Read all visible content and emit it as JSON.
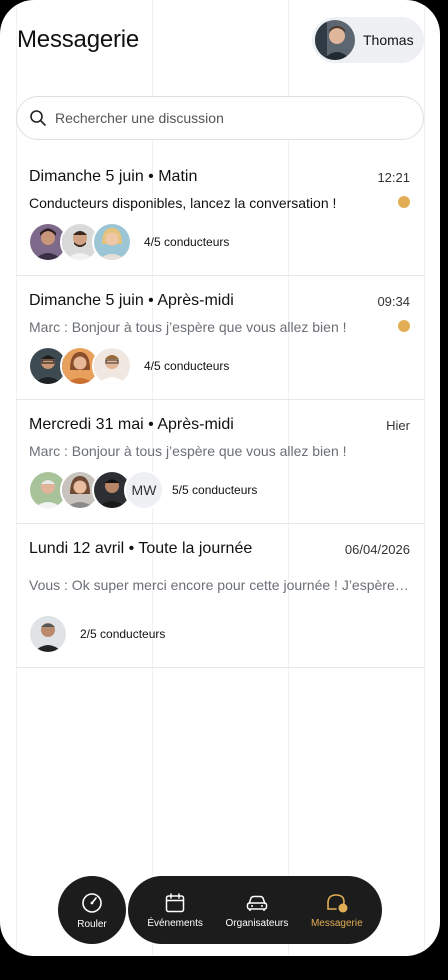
{
  "header": {
    "title": "Messagerie",
    "user_name": "Thomas"
  },
  "search": {
    "placeholder": "Rechercher une discussion"
  },
  "conversations": [
    {
      "title": "Dimanche 5 juin • Matin",
      "time": "12:21",
      "message": "Conducteurs disponibles, lancez la conversation !",
      "unread": true,
      "drivers": "4/5 conducteurs"
    },
    {
      "title": "Dimanche 5 juin • Après-midi",
      "time": "09:34",
      "message": "Marc : Bonjour à tous j’espère que vous allez bien !",
      "unread": true,
      "drivers": "4/5 conducteurs"
    },
    {
      "title": "Mercredi 31 mai • Après-midi",
      "time": "Hier",
      "message": "Marc : Bonjour à tous j’espère que vous allez bien !",
      "unread": false,
      "avatar_initials": "MW",
      "drivers": "5/5 conducteurs"
    },
    {
      "title": "Lundi 12 avril • Toute la journée",
      "time": "06/04/2026",
      "message": "Vous : Ok super merci encore pour cette journée ! J’espère que…",
      "unread": false,
      "drivers": "2/5 conducteurs"
    }
  ],
  "nav": {
    "rouler": "Rouler",
    "evenements": "Événements",
    "organisateurs": "Organisateurs",
    "messagerie": "Messagerie"
  },
  "colors": {
    "accent": "#e2ae55",
    "nav_bg": "#1c1c1c",
    "muted": "#6b6f76"
  }
}
